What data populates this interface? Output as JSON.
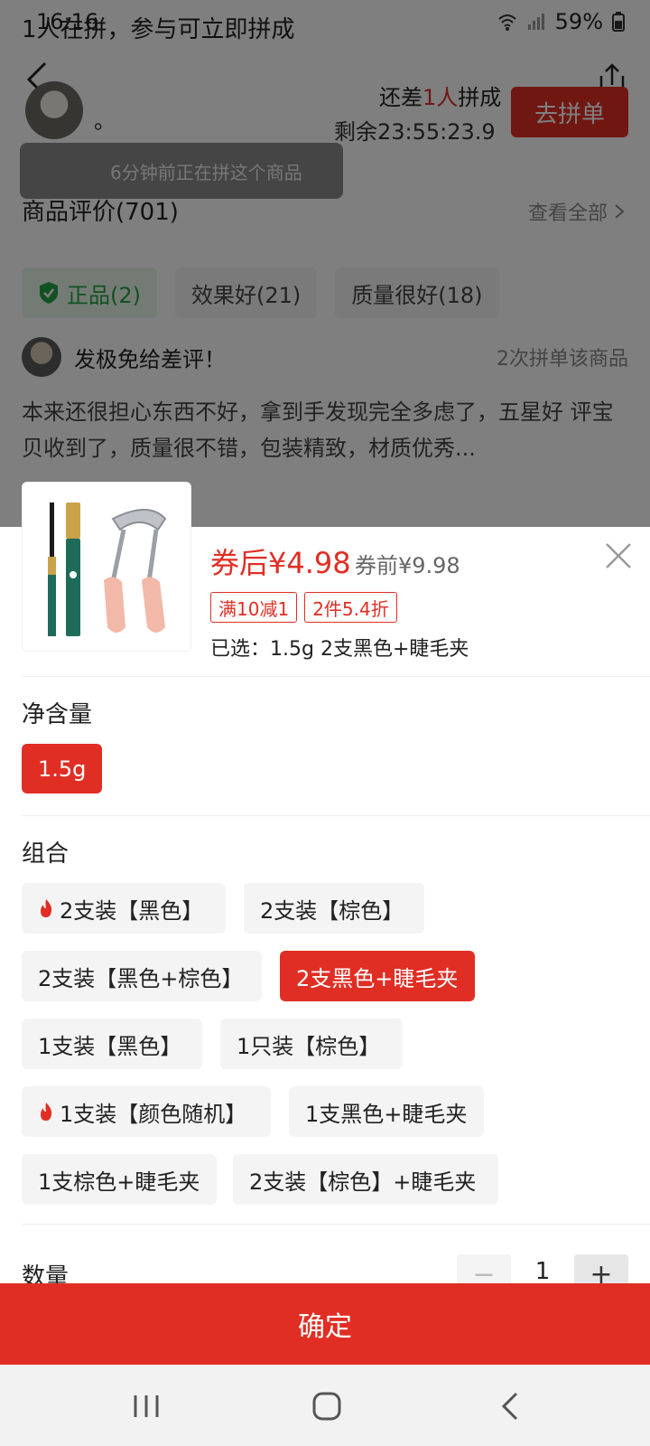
{
  "status_bar": {
    "time": "16:16",
    "battery": "59%"
  },
  "group_banner": "1人在拼，参与可立即拼成",
  "group_buy": {
    "member_name": "。",
    "remain_prefix": "还差",
    "remain_count": "1人",
    "remain_suffix": "拼成",
    "countdown": "剩余23:55:23.9",
    "join_button": "去拼单"
  },
  "toast": "6分钟前正在拼这个商品",
  "reviews": {
    "header": "商品评价(701)",
    "see_all": "查看全部",
    "tags": [
      "正品(2)",
      "效果好(21)",
      "质量很好(18)"
    ],
    "reviewer_name": "发极免给差评！",
    "reviewer_meta": "2次拼单该商品",
    "text": "本来还很担心东西不好，拿到手发现完全多虑了，五星好 评宝贝收到了，质量很不错，包装精致，材质优秀..."
  },
  "sheet": {
    "price_after": "券后¥4.98",
    "price_before": "券前¥9.98",
    "promos": [
      "满10减1",
      "2件5.4折"
    ],
    "selected": "已选：1.5g 2支黑色+睫毛夹",
    "net_content_title": "净含量",
    "net_content_options": [
      "1.5g"
    ],
    "combo_title": "组合",
    "combo_options": [
      "2支装【黑色】",
      "2支装【棕色】",
      "2支装【黑色+棕色】",
      "2支黑色+睫毛夹",
      "1支装【黑色】",
      "1只装【棕色】",
      "1支装【颜色随机】",
      "1支黑色+睫毛夹",
      "1支棕色+睫毛夹",
      "2支装【棕色】+睫毛夹"
    ],
    "quantity_label": "数量",
    "quantity": "1",
    "minus": "−",
    "plus": "+",
    "confirm": "确定"
  },
  "colors": {
    "accent": "#e02e24",
    "genuine_green": "#25a244"
  },
  "icons": [
    "back-icon",
    "share-icon",
    "shield-icon",
    "close-icon",
    "fire-icon",
    "nav-recent-icon",
    "nav-home-icon",
    "nav-back-icon"
  ]
}
